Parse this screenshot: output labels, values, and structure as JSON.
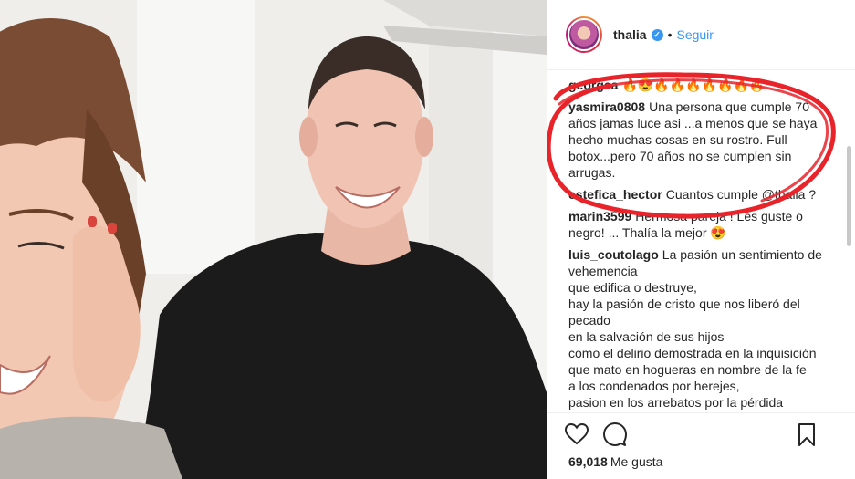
{
  "post": {
    "username": "thalia",
    "follow_label": "Seguir",
    "dot": "•",
    "verified_glyph": "✓"
  },
  "comments": [
    {
      "user": "georgea",
      "lines": [
        "🔥😍🔥🔥🔥🔥🔥🔥🔥"
      ]
    },
    {
      "user": "yasmira0808",
      "lines": [
        "Una persona que cumple 70",
        "años jamas luce asi ...a menos que se haya",
        "hecho muchas cosas en su rostro. Full",
        "botox...pero 70 años no se cumplen sin",
        "arrugas."
      ]
    },
    {
      "user": "estefica_hector",
      "lines": [
        "Cuantos cumple @thalia ?"
      ]
    },
    {
      "user": "marin3599",
      "lines": [
        "Hermosa pareja ! Les guste o",
        "negro! ... Thalía la mejor 😍"
      ]
    },
    {
      "user": "luis_coutolago",
      "lines": [
        "La pasión un sentimiento de",
        "vehemencia",
        "que edifica o destruye,",
        "hay la pasión de cristo que nos liberó del",
        "pecado",
        "en la salvación de sus hijos",
        "como el delirio demostrada en la inquisición",
        "que mato en hogueras en nombre de la fe",
        "a los condenados por herejes,",
        "pasion en los arrebatos por la pérdida"
      ]
    }
  ],
  "likes": {
    "count": "69,018",
    "label": "Me gusta"
  },
  "icons": [
    "heart-icon",
    "comment-icon",
    "bookmark-icon",
    "verified-icon"
  ],
  "colors": {
    "link": "#3897f0",
    "annotation": "#e8232a",
    "text": "#262626"
  }
}
